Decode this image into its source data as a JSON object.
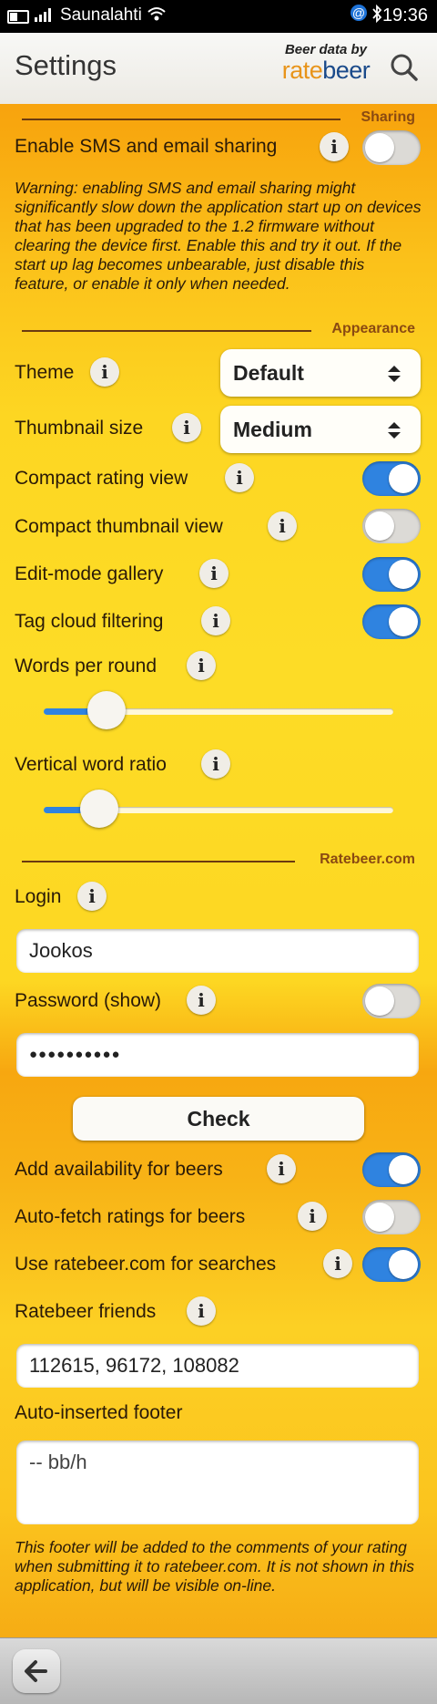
{
  "status_bar": {
    "carrier": "Saunalahti",
    "time": "19:36"
  },
  "header": {
    "title": "Settings",
    "brand_tagline": "Beer data by",
    "brand_name_a": "rate",
    "brand_name_b": "beer"
  },
  "sections": {
    "sharing": "Sharing",
    "appearance": "Appearance",
    "ratebeer": "Ratebeer.com"
  },
  "sharing": {
    "enable_label": "Enable SMS and email sharing",
    "enable_on": false,
    "warning": "Warning: enabling SMS and email sharing might significantly slow down the application start up on devices that has been upgraded to the 1.2 firmware without clearing the device first. Enable this and try it out. If the start up lag becomes unbearable, just disable this feature, or enable it only when needed."
  },
  "appearance": {
    "theme_label": "Theme",
    "theme_value": "Default",
    "thumb_label": "Thumbnail size",
    "thumb_value": "Medium",
    "compact_rating_label": "Compact rating view",
    "compact_rating_on": true,
    "compact_thumb_label": "Compact thumbnail view",
    "compact_thumb_on": false,
    "edit_gallery_label": "Edit-mode gallery",
    "edit_gallery_on": true,
    "tag_cloud_label": "Tag cloud filtering",
    "tag_cloud_on": true,
    "words_label": "Words per round",
    "words_level": 0.18,
    "ratio_label": "Vertical word ratio",
    "ratio_level": 0.16
  },
  "ratebeer": {
    "login_label": "Login",
    "login_value": "Jookos",
    "password_label": "Password (show)",
    "password_show_on": false,
    "password_value": "●●●●●●●●●●",
    "check_label": "Check",
    "availability_label": "Add availability for beers",
    "availability_on": true,
    "autofetch_label": "Auto-fetch ratings for beers",
    "autofetch_on": false,
    "use_search_label": "Use ratebeer.com for searches",
    "use_search_on": true,
    "friends_label": "Ratebeer friends",
    "friends_value": "112615, 96172, 108082",
    "footer_label": "Auto-inserted footer",
    "footer_value": "-- bb/h",
    "footer_note": "This footer will be added to the comments of your rating when submitting it to ratebeer.com. It is not shown in this application, but will be visible on-line."
  },
  "info_glyph": "i",
  "colors": {
    "switch_on": "#2f83e0",
    "switch_off": "#dcdad6",
    "accent_orange": "#e8941a",
    "brand_blue": "#1a4a8a"
  }
}
